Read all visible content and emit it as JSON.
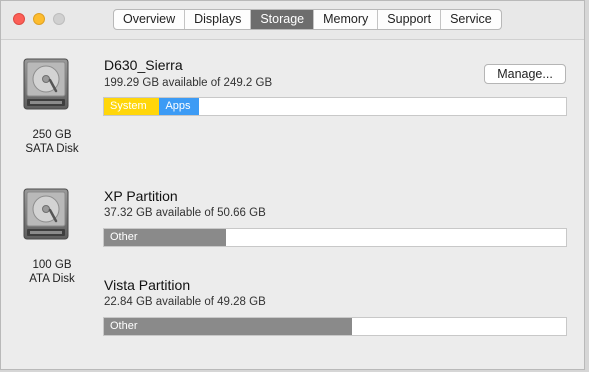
{
  "tabs": [
    {
      "label": "Overview"
    },
    {
      "label": "Displays"
    },
    {
      "label": "Storage"
    },
    {
      "label": "Memory"
    },
    {
      "label": "Support"
    },
    {
      "label": "Service"
    }
  ],
  "active_tab": "Storage",
  "disks": [
    {
      "size": "250 GB",
      "type": "SATA Disk",
      "volumes": [
        {
          "name": "D630_Sierra",
          "available": "199.29 GB available of 249.2 GB",
          "manage_label": "Manage...",
          "segments": [
            {
              "label": "System",
              "fraction": 0.12,
              "color": "#ffd60a"
            },
            {
              "label": "Apps",
              "fraction": 0.085,
              "color": "#3c9bf5"
            }
          ]
        }
      ]
    },
    {
      "size": "100 GB",
      "type": "ATA Disk",
      "volumes": [
        {
          "name": "XP Partition",
          "available": "37.32 GB available of 50.66 GB",
          "segments": [
            {
              "label": "Other",
              "fraction": 0.263,
              "color": "#8a8a8a"
            }
          ]
        },
        {
          "name": "Vista Partition",
          "available": "22.84 GB available of 49.28 GB",
          "segments": [
            {
              "label": "Other",
              "fraction": 0.537,
              "color": "#8a8a8a"
            }
          ]
        }
      ]
    }
  ]
}
